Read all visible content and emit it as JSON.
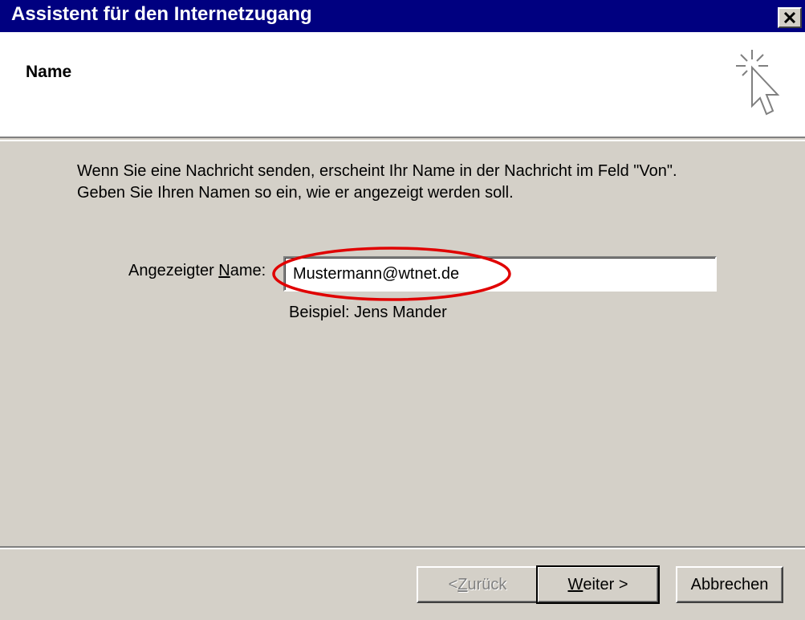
{
  "window": {
    "title": "Assistent für den Internetzugang",
    "close_icon": "close-icon"
  },
  "header": {
    "heading": "Name",
    "icon": "wizard-cursor-icon"
  },
  "body": {
    "description_line1": "Wenn Sie eine Nachricht senden, erscheint Ihr Name in der Nachricht im Feld \"Von\".",
    "description_line2": "Geben Sie Ihren Namen so ein, wie er angezeigt werden soll.",
    "field_label_prefix": "Angezeigter ",
    "field_label_accel": "N",
    "field_label_suffix": "ame:",
    "display_name_value": "Mustermann@wtnet.de",
    "example_text": "Beispiel: Jens Mander",
    "highlight_color": "#e00000"
  },
  "footer": {
    "back_prefix": "< ",
    "back_accel": "Z",
    "back_suffix": "urück",
    "next_accel": "W",
    "next_suffix": "eiter >",
    "cancel_label": "Abbrechen"
  }
}
